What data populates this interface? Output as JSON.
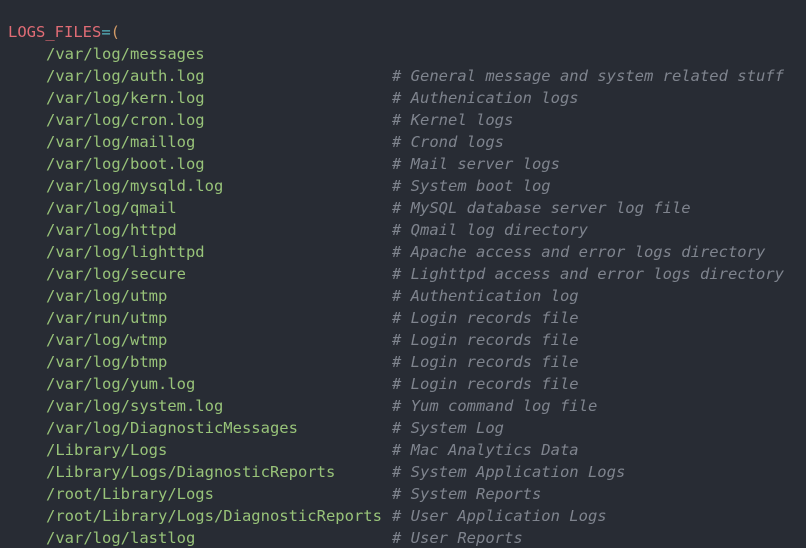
{
  "code": {
    "var_name": "LOGS_FILES",
    "equals": "=",
    "open_paren": "(",
    "close_paren": ")",
    "entries": [
      {
        "path": "/var/log/messages",
        "comment": "# General message and system related stuff"
      },
      {
        "path": "/var/log/auth.log",
        "comment": "# Authenication logs"
      },
      {
        "path": "/var/log/kern.log",
        "comment": "# Kernel logs"
      },
      {
        "path": "/var/log/cron.log",
        "comment": "# Crond logs"
      },
      {
        "path": "/var/log/maillog",
        "comment": "# Mail server logs"
      },
      {
        "path": "/var/log/boot.log",
        "comment": "# System boot log"
      },
      {
        "path": "/var/log/mysqld.log",
        "comment": "# MySQL database server log file"
      },
      {
        "path": "/var/log/qmail",
        "comment": "# Qmail log directory"
      },
      {
        "path": "/var/log/httpd",
        "comment": "# Apache access and error logs directory"
      },
      {
        "path": "/var/log/lighttpd",
        "comment": "# Lighttpd access and error logs directory"
      },
      {
        "path": "/var/log/secure",
        "comment": "# Authentication log"
      },
      {
        "path": "/var/log/utmp",
        "comment": "# Login records file"
      },
      {
        "path": "/var/run/utmp",
        "comment": "# Login records file"
      },
      {
        "path": "/var/log/wtmp",
        "comment": "# Login records file"
      },
      {
        "path": "/var/log/btmp",
        "comment": "# Login records file"
      },
      {
        "path": "/var/log/yum.log",
        "comment": "# Yum command log file"
      },
      {
        "path": "/var/log/system.log",
        "comment": "# System Log"
      },
      {
        "path": "/var/log/DiagnosticMessages",
        "comment": "# Mac Analytics Data"
      },
      {
        "path": "/Library/Logs",
        "comment": "# System Application Logs"
      },
      {
        "path": "/Library/Logs/DiagnosticReports",
        "comment": "# System Reports"
      },
      {
        "path": "/root/Library/Logs",
        "comment": "# User Application Logs"
      },
      {
        "path": "/root/Library/Logs/DiagnosticReports",
        "comment": "# User Reports"
      },
      {
        "path": "/var/log/lastlog",
        "comment": ""
      }
    ]
  },
  "colors": {
    "background": "#282c34",
    "variable": "#e06c75",
    "string_path": "#98c379",
    "comment": "#7f848e",
    "paren": "#d19a66"
  }
}
